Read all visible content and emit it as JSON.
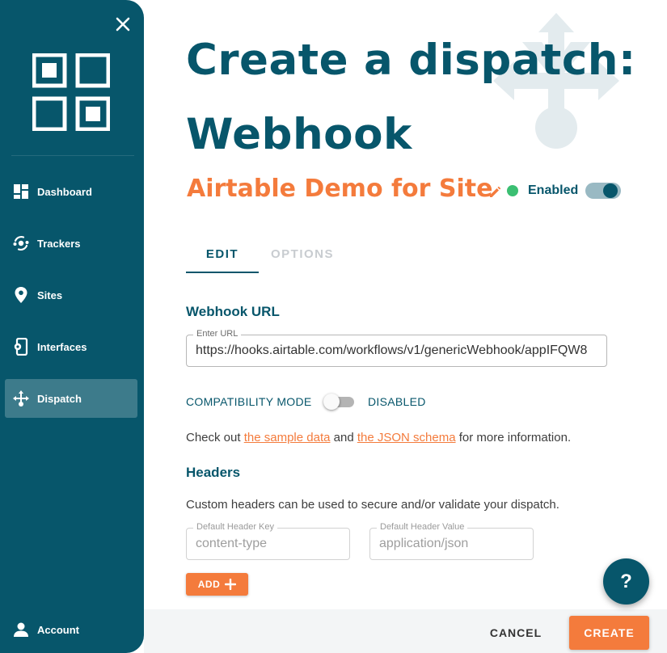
{
  "sidebar": {
    "items": [
      {
        "label": "Dashboard",
        "icon": "dashboard-icon"
      },
      {
        "label": "Trackers",
        "icon": "trackers-icon"
      },
      {
        "label": "Sites",
        "icon": "location-pin-icon"
      },
      {
        "label": "Interfaces",
        "icon": "interfaces-icon"
      },
      {
        "label": "Dispatch",
        "icon": "dispatch-arrows-icon",
        "active": true
      }
    ],
    "account_label": "Account"
  },
  "header": {
    "title_line1": "Create a dispatch:",
    "title_line2": "Webhook",
    "subtitle": "Airtable Demo for Site",
    "status_label": "Enabled",
    "status_enabled": true
  },
  "tabs": [
    {
      "label": "EDIT",
      "active": true
    },
    {
      "label": "OPTIONS",
      "active": false
    }
  ],
  "webhook": {
    "section_title": "Webhook URL",
    "field_label": "Enter URL",
    "field_value": "https://hooks.airtable.com/workflows/v1/genericWebhook/appIFQW8"
  },
  "compatibility": {
    "label": "COMPATIBILITY MODE",
    "state_label": "DISABLED",
    "enabled": false
  },
  "info": {
    "prefix": "Check out ",
    "link1": "the sample data",
    "middle": " and ",
    "link2": "the JSON schema",
    "suffix": " for more information."
  },
  "headers": {
    "section_title": "Headers",
    "description": "Custom headers can be used to secure and/or validate your dispatch.",
    "key_label": "Default Header Key",
    "key_value": "content-type",
    "value_label": "Default Header Value",
    "value_value": "application/json",
    "add_label": "ADD",
    "add_icon": "plus-icon"
  },
  "footer": {
    "cancel_label": "CANCEL",
    "create_label": "CREATE"
  },
  "help": {
    "label": "?"
  },
  "colors": {
    "primary": "#07566b",
    "accent": "#f47b3c",
    "status_green": "#3bbf72"
  }
}
